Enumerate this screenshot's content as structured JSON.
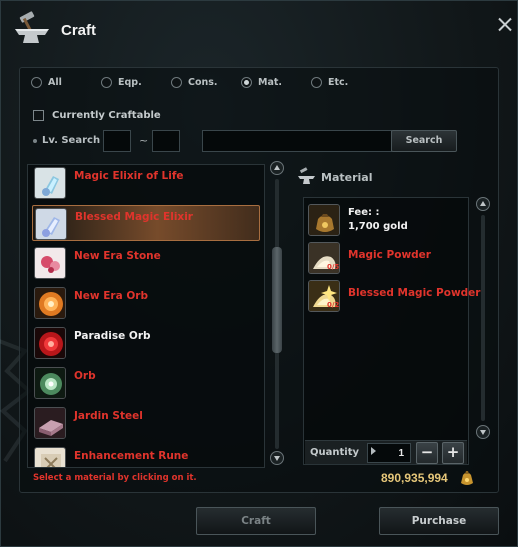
{
  "window": {
    "title": "Craft",
    "icon": "anvil-hammer-icon"
  },
  "filters": [
    {
      "label": "All",
      "selected": false
    },
    {
      "label": "Eqp.",
      "selected": false
    },
    {
      "label": "Cons.",
      "selected": false
    },
    {
      "label": "Mat.",
      "selected": true
    },
    {
      "label": "Etc.",
      "selected": false
    }
  ],
  "currently_craftable": {
    "label": "Currently Craftable",
    "checked": false
  },
  "level_search": {
    "label": "Lv. Search",
    "min": "",
    "max": "",
    "tilde": "~",
    "query": "",
    "button": "Search"
  },
  "recipes": [
    {
      "label": "Magic Elixir of Life",
      "color": "red",
      "selected": false,
      "icon": "potion-bottle-icon"
    },
    {
      "label": "Blessed Magic Elixir",
      "color": "red",
      "selected": true,
      "icon": "blessed-potion-icon"
    },
    {
      "label": "New Era Stone",
      "color": "red",
      "selected": false,
      "icon": "era-stone-icon"
    },
    {
      "label": "New Era Orb",
      "color": "red",
      "selected": false,
      "icon": "orange-orb-icon"
    },
    {
      "label": "Paradise Orb",
      "color": "white",
      "selected": false,
      "icon": "red-orb-icon"
    },
    {
      "label": "Orb",
      "color": "red",
      "selected": false,
      "icon": "green-orb-icon"
    },
    {
      "label": "Jardin Steel",
      "color": "red",
      "selected": false,
      "icon": "steel-ingot-icon"
    },
    {
      "label": "Enhancement Rune",
      "color": "red",
      "selected": false,
      "icon": "rune-icon"
    }
  ],
  "material": {
    "title": "Material",
    "fee_label": "Fee: :",
    "fee_value": "1,700 gold",
    "items": [
      {
        "name": "Magic Powder",
        "count": "0/5",
        "icon": "magic-powder-icon"
      },
      {
        "name": "Blessed Magic Powder",
        "count": "0/2",
        "icon": "blessed-powder-icon"
      }
    ]
  },
  "quantity": {
    "label": "Quantity",
    "value": "1",
    "minus": "−",
    "plus": "+"
  },
  "hint": "Select a material by clicking on it.",
  "gold": "890,935,994",
  "buttons": {
    "craft": "Craft",
    "purchase": "Purchase"
  },
  "colors": {
    "red_text": "#e0342c",
    "gold_text": "#e6c77a",
    "selection": "#a86e40"
  }
}
